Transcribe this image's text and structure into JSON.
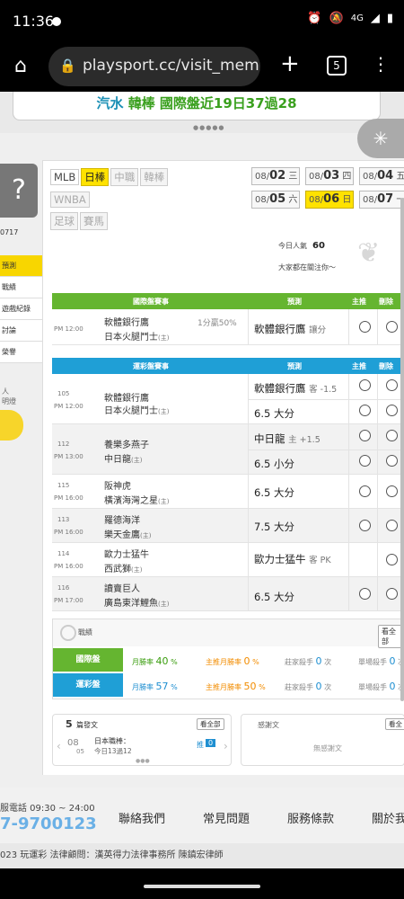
{
  "status": {
    "time": "11:36",
    "network": "4G"
  },
  "browser": {
    "url": "playsport.cc/visit_mem",
    "tab_count": "5"
  },
  "banner": {
    "part1": "汽水",
    "part2": "韓棒 國際盤近19日37過28"
  },
  "sidebar": {
    "id_fragment": "0717",
    "items": [
      {
        "label": "預測"
      },
      {
        "label": "戰績"
      },
      {
        "label": "遊戲紀錄"
      },
      {
        "label": "討論"
      },
      {
        "label": "榮譽"
      }
    ],
    "promo": {
      "line1": "人",
      "line2": "明燈"
    }
  },
  "leagues": [
    {
      "label": "MLB"
    },
    {
      "label": "日棒"
    },
    {
      "label": "中職"
    },
    {
      "label": "韓棒"
    },
    {
      "label": "WNBA"
    },
    {
      "label": "足球"
    },
    {
      "label": "賽馬"
    }
  ],
  "dates": [
    {
      "md": "08/",
      "day": "02",
      "wd": "三"
    },
    {
      "md": "08/",
      "day": "03",
      "wd": "四"
    },
    {
      "md": "08/",
      "day": "04",
      "wd": "五"
    },
    {
      "md": "08/",
      "day": "05",
      "wd": "六"
    },
    {
      "md": "08/",
      "day": "06",
      "wd": "日"
    },
    {
      "md": "08/",
      "day": "07",
      "wd": "一"
    }
  ],
  "popularity": {
    "label": "今日人氣",
    "value": "60",
    "note": "大家都在關注你～"
  },
  "intl": {
    "header": {
      "match": "國際盤賽事",
      "pred": "預測",
      "main": "主推",
      "del": "刪除"
    },
    "rows": [
      {
        "time": "PM 12:00",
        "team1": "軟體銀行鷹",
        "team2": "日本火腿鬥士",
        "host": "(主)",
        "line": "1分贏50%",
        "pred": "軟體銀行鷹",
        "pred_note": "讓分"
      }
    ]
  },
  "sports": {
    "header": {
      "match": "運彩盤賽事",
      "pred": "預測",
      "main": "主推",
      "del": "刪除"
    },
    "rows": [
      {
        "num": "105",
        "time": "PM 12:00",
        "team1": "軟體銀行鷹",
        "team2": "日本火腿鬥士",
        "host": "(主)",
        "pred1": "軟體銀行鷹",
        "pred1_note": "客 -1.5",
        "pred2": "6.5 大分",
        "pred2_note": ""
      },
      {
        "num": "112",
        "time": "PM 13:00",
        "team1": "養樂多燕子",
        "team2": "中日龍",
        "host": "(主)",
        "pred1": "中日龍",
        "pred1_note": "主 +1.5",
        "pred2": "6.5 小分",
        "pred2_note": ""
      },
      {
        "num": "115",
        "time": "PM 16:00",
        "team1": "阪神虎",
        "team2": "橫濱海灣之星",
        "host": "(主)",
        "pred1": "6.5 大分",
        "pred1_note": ""
      },
      {
        "num": "113",
        "time": "PM 16:00",
        "team1": "羅德海洋",
        "team2": "樂天金鷹",
        "host": "(主)",
        "pred1": "7.5 大分",
        "pred1_note": ""
      },
      {
        "num": "114",
        "time": "PM 16:00",
        "team1": "歐力士猛牛",
        "team2": "西武獅",
        "host": "(主)",
        "pred1": "歐力士猛牛",
        "pred1_note": "客 PK"
      },
      {
        "num": "116",
        "time": "PM 17:00",
        "team1": "讀賣巨人",
        "team2": "廣島東洋鯉魚",
        "host": "(主)",
        "pred1": "6.5 大分",
        "pred1_note": ""
      }
    ]
  },
  "record": {
    "title": "戰績",
    "see_all": "看全部",
    "rows": [
      {
        "tag": "國際盤",
        "month_label": "月勝率",
        "month": "40",
        "main_label": "主推月勝率",
        "main": "0",
        "zhuang_label": "莊家殺手",
        "zhuang": "0",
        "single_label": "單場殺手",
        "single": "0",
        "pct": "%",
        "times": "次"
      },
      {
        "tag": "運彩盤",
        "month_label": "月勝率",
        "month": "57",
        "main_label": "主推月勝率",
        "main": "50",
        "zhuang_label": "莊家殺手",
        "zhuang": "0",
        "single_label": "單場殺手",
        "single": "0",
        "pct": "%",
        "times": "次"
      }
    ],
    "colors": {
      "intl": "#65b530",
      "sports": "#1f9fd6"
    }
  },
  "posts": {
    "count": "5",
    "label": "篇發文",
    "see_all": "看全部",
    "item_md": "08",
    "item_d": "05",
    "item_title": "日本職棒：",
    "item_sub": "今日13過12",
    "push_label": "推",
    "push_count": "0"
  },
  "follows": {
    "label": "感謝文",
    "see_all": "看全",
    "empty": "無感謝文"
  },
  "footer": {
    "phone_hours": "服電話 09:30 ~ 24:00",
    "phone": "7-9700123",
    "links": [
      {
        "label": "聯絡我們"
      },
      {
        "label": "常見問題"
      },
      {
        "label": "服務條款"
      },
      {
        "label": "關於我"
      }
    ],
    "copyright": "023 玩運彩 法律顧問：漢英得力法律事務所 陳鎮宏律師"
  }
}
